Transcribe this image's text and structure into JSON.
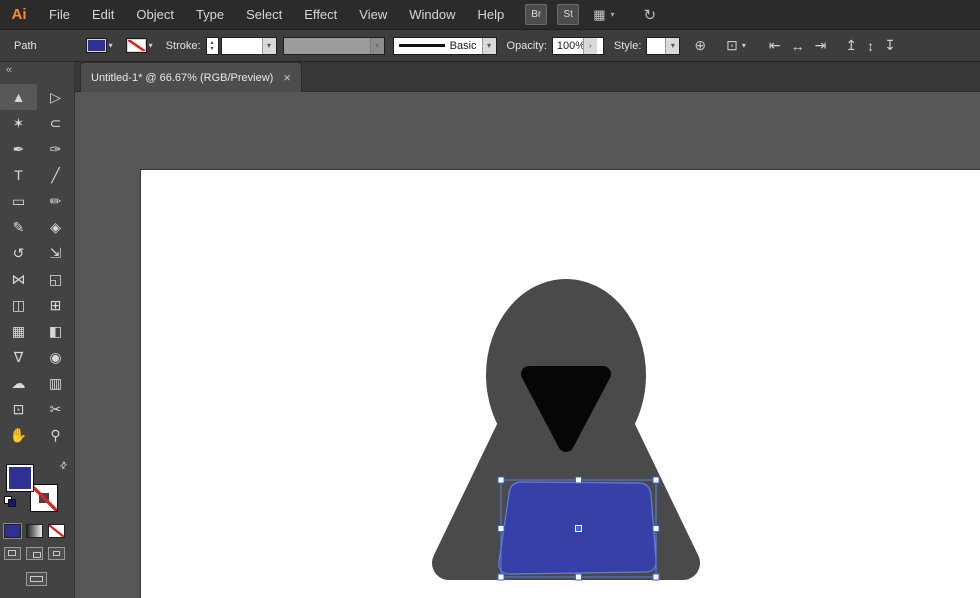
{
  "menubar": {
    "logo": "Ai",
    "items": [
      "File",
      "Edit",
      "Object",
      "Type",
      "Select",
      "Effect",
      "View",
      "Window",
      "Help"
    ],
    "br_label": "Br",
    "st_label": "St"
  },
  "controlbar": {
    "selection_type": "Path",
    "stroke_label": "Stroke:",
    "brush_name": "Basic",
    "opacity_label": "Opacity:",
    "opacity_value": "100%",
    "style_label": "Style:"
  },
  "tab": {
    "title": "Untitled-1* @ 66.67% (RGB/Preview)"
  },
  "glyphs": {
    "chevron_down": "▾",
    "chevron_right": "›",
    "spinner_up": "▴",
    "spinner_down": "▾",
    "collapse": "«",
    "close": "×",
    "swap": "⇄",
    "globe": "⊕",
    "transform": "⊡",
    "layout": "▦",
    "sync": "↻"
  },
  "toolbar": {
    "tools": [
      {
        "name": "selection-tool",
        "glyph": "▲"
      },
      {
        "name": "direct-selection-tool",
        "glyph": "▷"
      },
      {
        "name": "magic-wand-tool",
        "glyph": "✶"
      },
      {
        "name": "lasso-tool",
        "glyph": "⊂"
      },
      {
        "name": "pen-tool",
        "glyph": "✒"
      },
      {
        "name": "curvature-tool",
        "glyph": "✑"
      },
      {
        "name": "type-tool",
        "glyph": "T"
      },
      {
        "name": "line-segment-tool",
        "glyph": "╱"
      },
      {
        "name": "rectangle-tool",
        "glyph": "▭"
      },
      {
        "name": "paintbrush-tool",
        "glyph": "✏"
      },
      {
        "name": "shaper-tool",
        "glyph": "✎"
      },
      {
        "name": "eraser-tool",
        "glyph": "◈"
      },
      {
        "name": "rotate-tool",
        "glyph": "↺"
      },
      {
        "name": "scale-tool",
        "glyph": "⇲"
      },
      {
        "name": "width-tool",
        "glyph": "⋈"
      },
      {
        "name": "free-transform-tool",
        "glyph": "◱"
      },
      {
        "name": "shape-builder-tool",
        "glyph": "◫"
      },
      {
        "name": "perspective-grid-tool",
        "glyph": "⊞"
      },
      {
        "name": "mesh-tool",
        "glyph": "▦"
      },
      {
        "name": "gradient-tool",
        "glyph": "◧"
      },
      {
        "name": "eyedropper-tool",
        "glyph": "∇"
      },
      {
        "name": "blend-tool",
        "glyph": "◉"
      },
      {
        "name": "symbol-sprayer-tool",
        "glyph": "☁"
      },
      {
        "name": "column-graph-tool",
        "glyph": "▥"
      },
      {
        "name": "artboard-tool",
        "glyph": "⊡"
      },
      {
        "name": "slice-tool",
        "glyph": "✂"
      },
      {
        "name": "hand-tool",
        "glyph": "✋"
      },
      {
        "name": "zoom-tool",
        "glyph": "⚲"
      }
    ]
  },
  "align": [
    {
      "name": "align-horizontal-left",
      "glyph": "⇤"
    },
    {
      "name": "align-horizontal-center",
      "glyph": "↔"
    },
    {
      "name": "align-horizontal-right",
      "glyph": "⇥"
    },
    {
      "name": "align-vertical-top",
      "glyph": "↥"
    },
    {
      "name": "align-vertical-center",
      "glyph": "↕"
    },
    {
      "name": "align-vertical-bottom",
      "glyph": "↧"
    }
  ],
  "colors": {
    "fill_swatch": "#2e3192",
    "figure_gray": "#4a4a4a",
    "face_black": "#060606",
    "laptop_blue": "#3640a6",
    "selection_blue": "#5f7de8",
    "handle_border": "#3465e0",
    "canvas_gray": "#575757",
    "ui_dark": "#2b2b2b",
    "logo_orange": "#ff8a1e"
  }
}
